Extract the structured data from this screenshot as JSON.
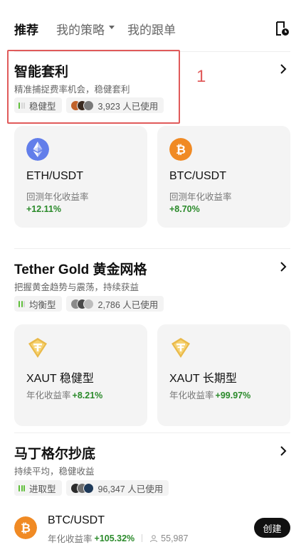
{
  "tabs": {
    "recommend": "推荐",
    "my_strategy": "我的策略",
    "my_copy": "我的跟单"
  },
  "sections": [
    {
      "title": "智能套利",
      "subtitle": "精准捕捉费率机会，稳健套利",
      "risk_label": "稳健型",
      "risk_level": 1,
      "users_text": "3,923 人已使用",
      "cards": [
        {
          "coin": "ETH",
          "pair": "ETH/USDT",
          "label": "回测年化收益率",
          "value": "+12.11%"
        },
        {
          "coin": "BTC",
          "pair": "BTC/USDT",
          "label": "回测年化收益率",
          "value": "+8.70%"
        }
      ]
    },
    {
      "title": "Tether Gold 黄金网格",
      "subtitle": "把握黄金趋势与震荡，持续获益",
      "risk_label": "均衡型",
      "risk_level": 2,
      "users_text": "2,786 人已使用",
      "cards": [
        {
          "coin": "XAUT",
          "pair": "XAUT 稳健型",
          "label": "年化收益率",
          "value": "+8.21%"
        },
        {
          "coin": "XAUT",
          "pair": "XAUT 长期型",
          "label": "年化收益率",
          "value": "+99.97%"
        }
      ]
    },
    {
      "title": "马丁格尔抄底",
      "subtitle": "持续平均，稳健收益",
      "risk_label": "进取型",
      "risk_level": 3,
      "users_text": "96,347 人已使用",
      "item": {
        "coin": "BTC",
        "pair": "BTC/USDT",
        "label": "年化收益率",
        "value": "+105.32%",
        "users": "55,987",
        "button": "创建"
      }
    }
  ],
  "annotation": "1",
  "colors": {
    "positive": "#2a8a2a",
    "annotation": "#e05a5a",
    "risk_on": "#5fbf3a",
    "eth": "#627eea",
    "btc": "#f08a24",
    "xaut": "#e9b949"
  }
}
